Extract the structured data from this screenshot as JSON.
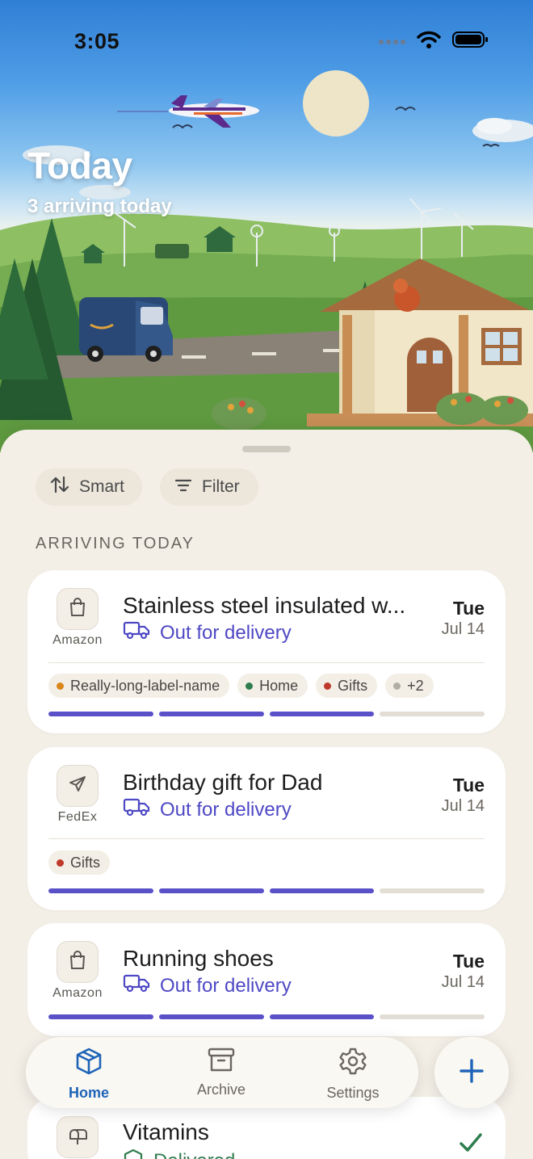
{
  "status_bar": {
    "time": "3:05"
  },
  "hero": {
    "title": "Today",
    "subtitle": "3 arriving today"
  },
  "toolbar": {
    "sort_label": "Smart",
    "filter_label": "Filter"
  },
  "section": {
    "title": "ARRIVING TODAY"
  },
  "deliveries": [
    {
      "title": "Stainless steel insulated w...",
      "carrier": "Amazon",
      "carrier_icon": "shopping-bag-icon",
      "status": "Out for delivery",
      "day": "Tue",
      "date": "Jul 14",
      "labels": [
        {
          "text": "Really-long-label-name",
          "color": "#d9861c"
        },
        {
          "text": "Home",
          "color": "#2e7d4f"
        },
        {
          "text": "Gifts",
          "color": "#c0392b"
        },
        {
          "text": "+2",
          "color": "#b3aea5"
        }
      ],
      "progress_steps_done": 3,
      "progress_steps_total": 4
    },
    {
      "title": "Birthday gift for Dad",
      "carrier": "FedEx",
      "carrier_icon": "paper-plane-icon",
      "status": "Out for delivery",
      "day": "Tue",
      "date": "Jul 14",
      "labels": [
        {
          "text": "Gifts",
          "color": "#c0392b"
        }
      ],
      "progress_steps_done": 3,
      "progress_steps_total": 4
    },
    {
      "title": "Running shoes",
      "carrier": "Amazon",
      "carrier_icon": "shopping-bag-icon",
      "status": "Out for delivery",
      "day": "Tue",
      "date": "Jul 14",
      "labels": [],
      "progress_steps_done": 3,
      "progress_steps_total": 4
    }
  ],
  "partial_item": {
    "title": "Vitamins",
    "status": "Delivered"
  },
  "tabbar": {
    "tabs": [
      {
        "label": "Home",
        "icon": "box-icon",
        "active": true
      },
      {
        "label": "Archive",
        "icon": "archive-icon",
        "active": false
      },
      {
        "label": "Settings",
        "icon": "gear-icon",
        "active": false
      }
    ],
    "add_icon": "plus-icon"
  },
  "colors": {
    "accent": "#4e48c4",
    "tab_active": "#1f64b8",
    "background": "#f3efe7",
    "delivered": "#2e7d4f"
  }
}
